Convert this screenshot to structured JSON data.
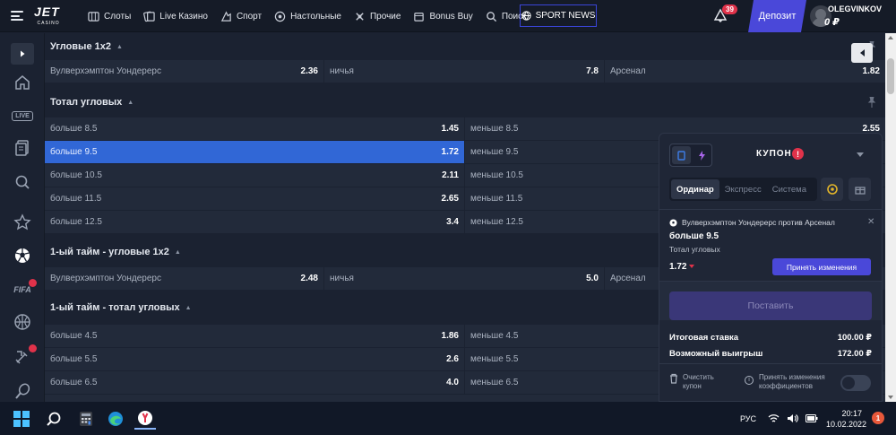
{
  "header": {
    "logo": "JET",
    "logo_sub": "CASINO",
    "nav": [
      {
        "label": "Слоты",
        "icon": "slots-icon"
      },
      {
        "label": "Live Казино",
        "icon": "live-casino-icon"
      },
      {
        "label": "Спорт",
        "icon": "sport-icon"
      },
      {
        "label": "Настольные",
        "icon": "table-games-icon"
      },
      {
        "label": "Прочие",
        "icon": "other-icon"
      },
      {
        "label": "Bonus Buy",
        "icon": "bonus-buy-icon"
      },
      {
        "label": "Поиск",
        "icon": "search-icon"
      }
    ],
    "sport_news": "SPORT NEWS",
    "notifications_count": "39",
    "deposit": "Депозит",
    "username": "OLEGVINKOV",
    "balance": "0 ₽"
  },
  "sidebar": {
    "live_label": "LIVE",
    "fifa_label": "FIFA",
    "items": [
      "expand-icon",
      "home-icon",
      "live-icon",
      "bet-slip-icon",
      "search-icon",
      "favorites-icon",
      "football-icon",
      "fifa-icon",
      "basketball-icon",
      "esports-icon",
      "tennis-icon"
    ]
  },
  "markets": {
    "corners_1x2": {
      "title": "Угловые 1х2",
      "cells": [
        {
          "label": "Вулверхэмптон Уондерерс",
          "odd": "2.36"
        },
        {
          "label": "ничья",
          "odd": "7.8"
        },
        {
          "label": "Арсенал",
          "odd": "1.82"
        }
      ]
    },
    "total_corners": {
      "title": "Тотал угловых",
      "rows": [
        {
          "over": "больше 8.5",
          "over_odd": "1.45",
          "under": "меньше 8.5",
          "under_odd": "2.55"
        },
        {
          "over": "больше 9.5",
          "over_odd": "1.72",
          "under": "меньше 9.5",
          "under_odd": ""
        },
        {
          "over": "больше 10.5",
          "over_odd": "2.11",
          "under": "меньше 10.5",
          "under_odd": ""
        },
        {
          "over": "больше 11.5",
          "over_odd": "2.65",
          "under": "меньше 11.5",
          "under_odd": ""
        },
        {
          "over": "больше 12.5",
          "over_odd": "3.4",
          "under": "меньше 12.5",
          "under_odd": ""
        }
      ]
    },
    "ht_corners_1x2": {
      "title": "1-ый тайм - угловые 1х2",
      "cells": [
        {
          "label": "Вулверхэмптон Уондерерс",
          "odd": "2.48"
        },
        {
          "label": "ничья",
          "odd": "5.0"
        },
        {
          "label": "Арсенал",
          "odd": ""
        }
      ]
    },
    "ht_total_corners": {
      "title": "1-ый тайм - тотал угловых",
      "rows": [
        {
          "over": "больше 4.5",
          "over_odd": "1.86",
          "under": "меньше 4.5",
          "under_odd": ""
        },
        {
          "over": "больше 5.5",
          "over_odd": "2.6",
          "under": "меньше 5.5",
          "under_odd": ""
        },
        {
          "over": "больше 6.5",
          "over_odd": "4.0",
          "under": "меньше 6.5",
          "under_odd": ""
        }
      ]
    }
  },
  "coupon": {
    "title": "КУПОН",
    "alert": "!",
    "tabs": [
      "Ординар",
      "Экспресс",
      "Система"
    ],
    "active_tab": "Ординар",
    "match": "Вулверхэмптон Уондерерс против Арсенал",
    "outcome": "больше 9.5",
    "market": "Тотал угловых",
    "odd": "1.72",
    "accept_button": "Принять изменения",
    "place_button": "Поставить",
    "total_stake_label": "Итоговая ставка",
    "total_stake": "100.00 ₽",
    "possible_win_label": "Возможный выигрыш",
    "possible_win": "172.00 ₽",
    "clear_label_1": "Очистить",
    "clear_label_2": "купон",
    "accept_odds_label_1": "Принять изменения",
    "accept_odds_label_2": "коэффициентов"
  },
  "taskbar": {
    "lang": "РУС",
    "time": "20:17",
    "date": "10.02.2022",
    "notifications": "1"
  },
  "colors": {
    "accent": "#4a48d9",
    "selected": "#3167d6",
    "alert": "#e0324a",
    "bg": "#1b2231",
    "row": "#222a3a"
  }
}
